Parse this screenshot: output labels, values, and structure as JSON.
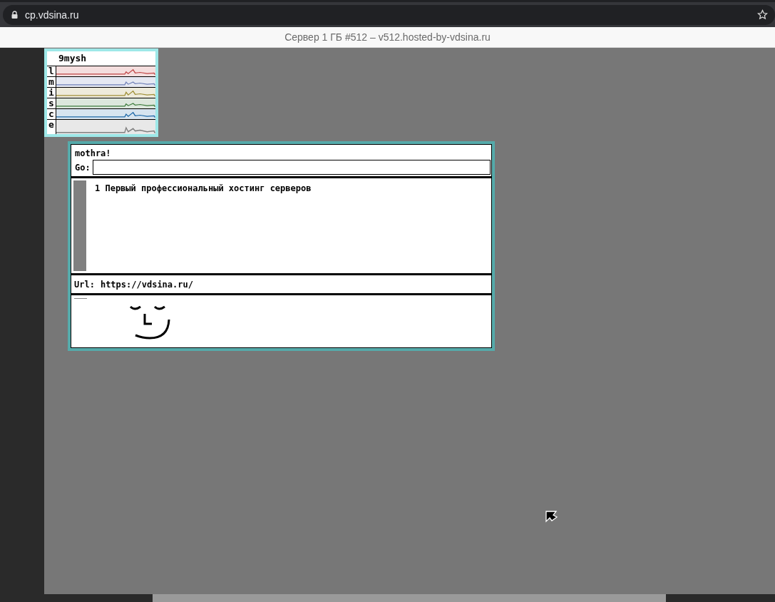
{
  "browser": {
    "url": "cp.vdsina.ru"
  },
  "page_title": "Сервер 1 ГБ #512 – v512.hosted-by-vdsina.ru",
  "stats": {
    "title": "9mysh",
    "rows": [
      {
        "label": "l",
        "color": "#c04848"
      },
      {
        "label": "m",
        "color": "#7080b8"
      },
      {
        "label": "i",
        "color": "#a09038"
      },
      {
        "label": "s",
        "color": "#3c7c3c"
      },
      {
        "label": "c",
        "color": "#1c68a8"
      },
      {
        "label": "e",
        "color": "#808080"
      }
    ]
  },
  "mothra": {
    "title": "mothra!",
    "go_label": "Go:",
    "links": [
      {
        "text": "1 Первый профессиональный хостинг серверов"
      }
    ],
    "url_label": "Url:",
    "url": "https://vdsina.ru/"
  }
}
